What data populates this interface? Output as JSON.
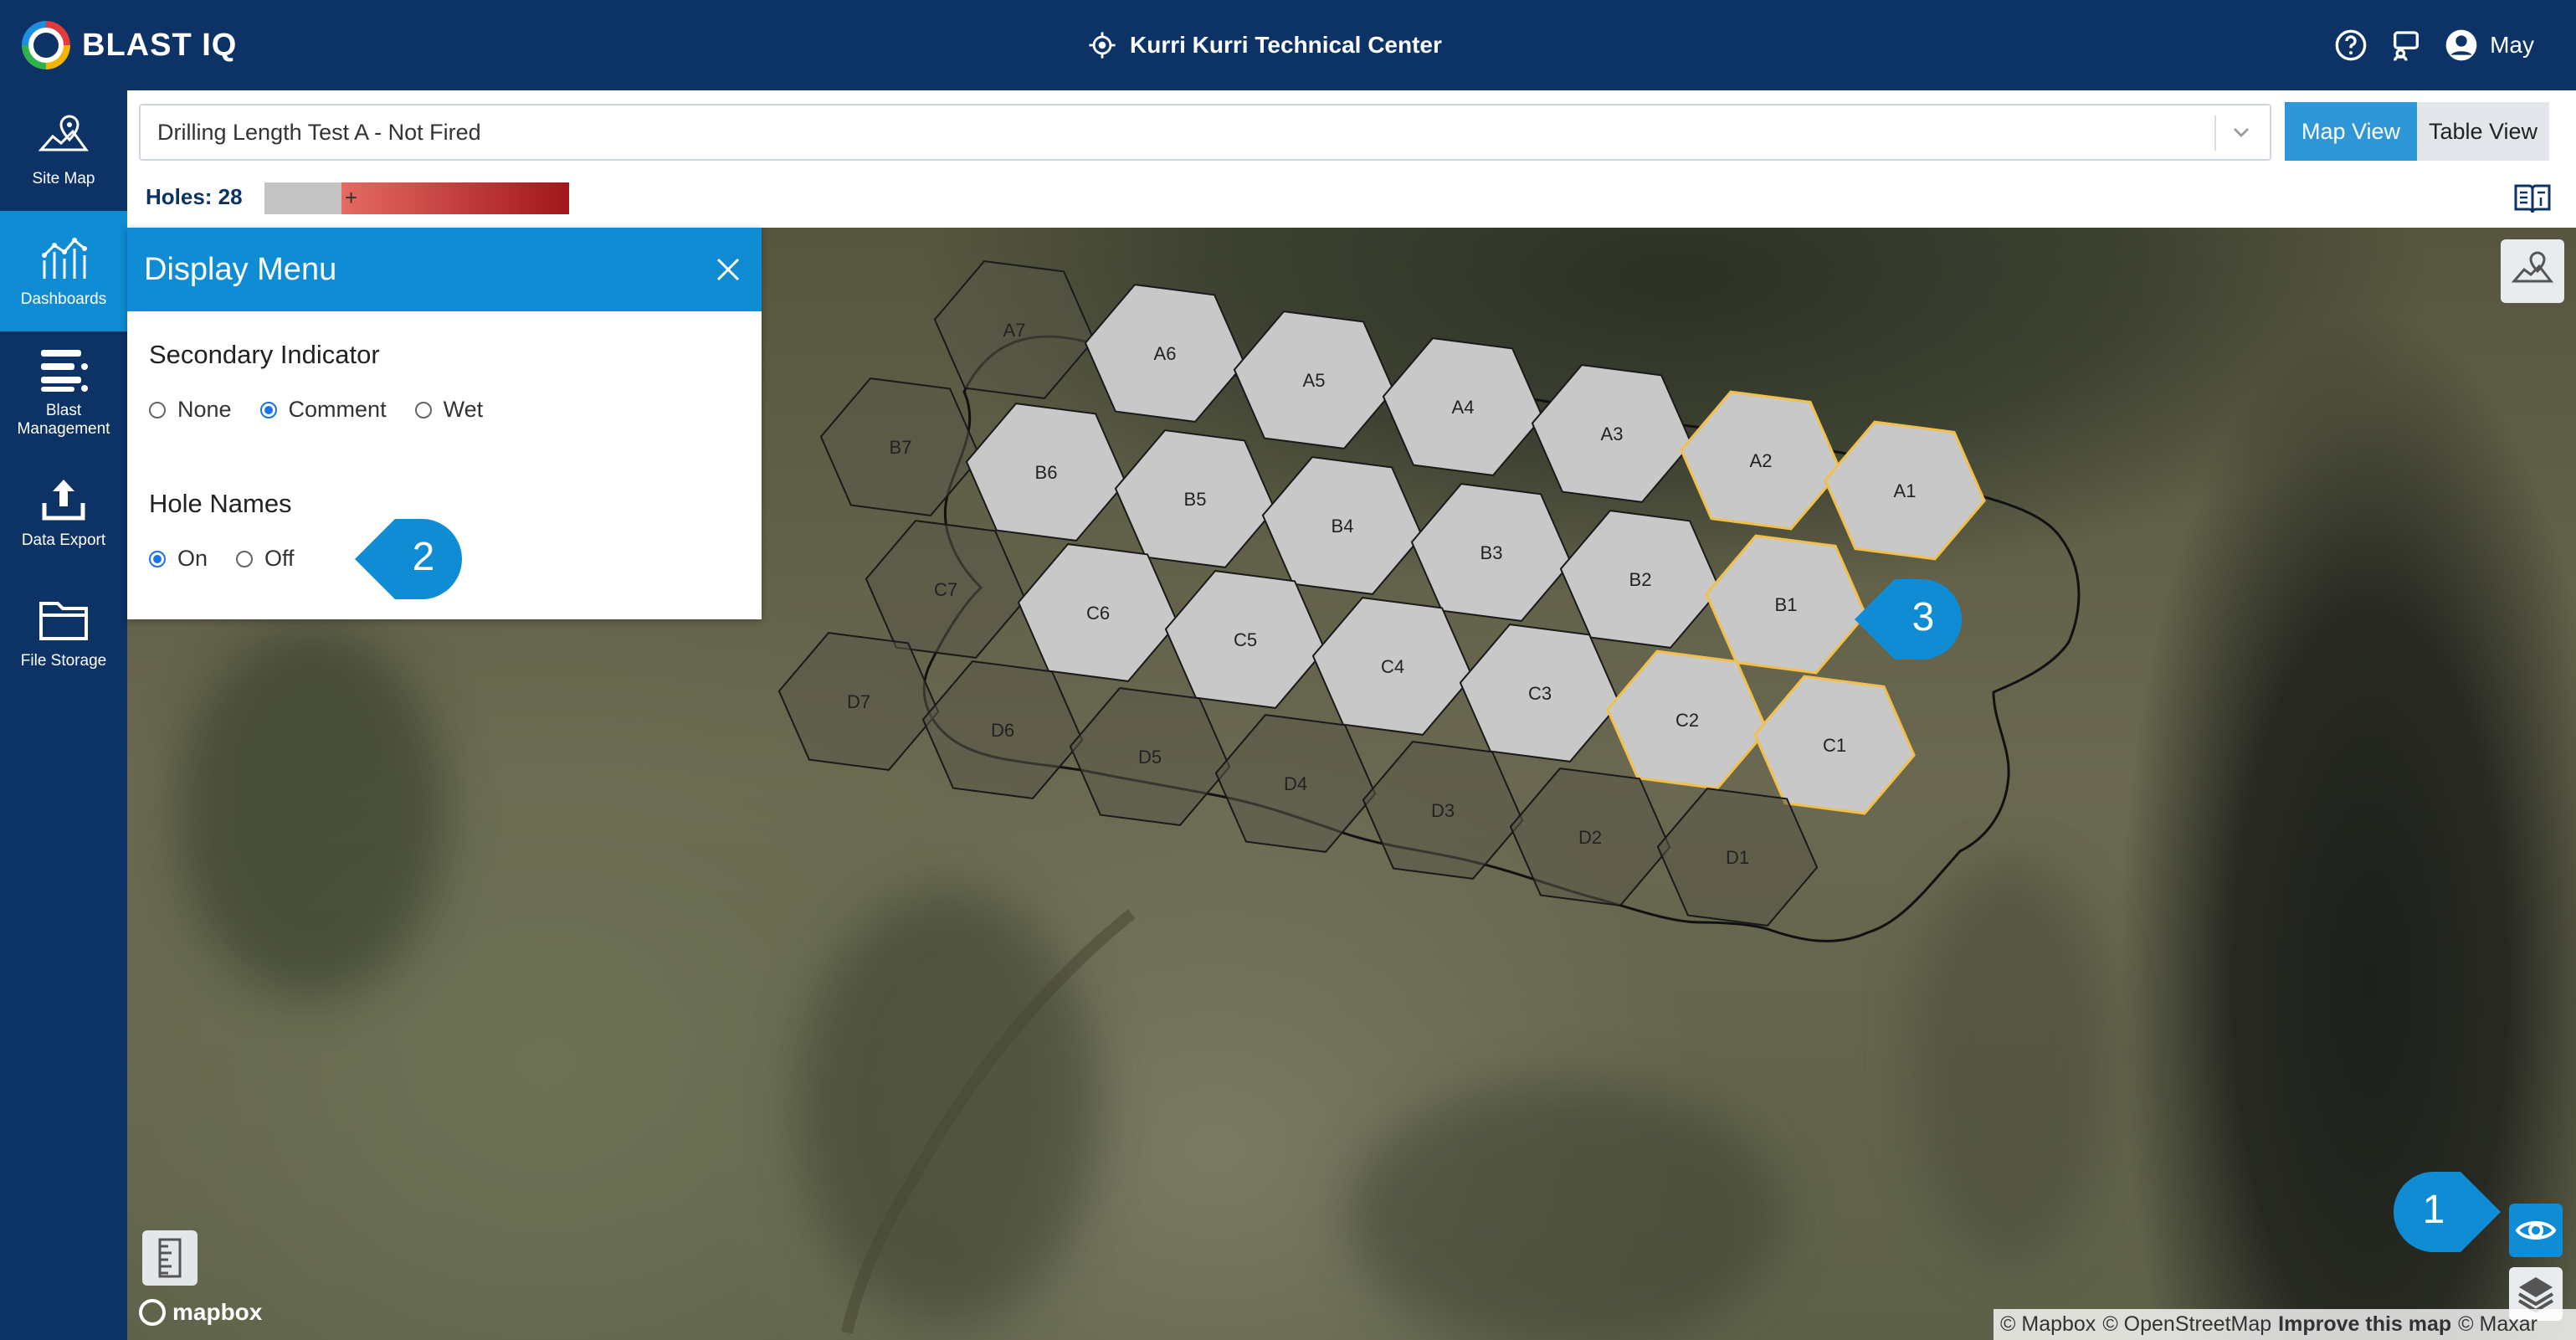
{
  "header": {
    "brand": "BLAST IQ",
    "site_title": "Kurri Kurri Technical Center",
    "user_name": "May"
  },
  "sidebar": {
    "items": [
      {
        "label": "Site Map",
        "icon": "map-pin-icon",
        "active": false
      },
      {
        "label": "Dashboards",
        "icon": "dashboard-icon",
        "active": true
      },
      {
        "label": "Blast Management",
        "icon": "list-icon",
        "active": false
      },
      {
        "label": "Data Export",
        "icon": "upload-icon",
        "active": false
      },
      {
        "label": "File Storage",
        "icon": "folder-icon",
        "active": false
      }
    ]
  },
  "toolbar": {
    "blast_select_value": "Drilling Length Test A - Not Fired",
    "map_view_label": "Map View",
    "table_view_label": "Table View",
    "holes_label": "Holes: 28",
    "legend_plus": "+"
  },
  "display_menu": {
    "title": "Display Menu",
    "secondary_indicator": {
      "heading": "Secondary Indicator",
      "options": [
        "None",
        "Comment",
        "Wet"
      ],
      "selected": "Comment"
    },
    "hole_names": {
      "heading": "Hole Names",
      "options": [
        "On",
        "Off"
      ],
      "selected": "On"
    }
  },
  "callouts": {
    "one": "1",
    "two": "2",
    "three": "3"
  },
  "holes": {
    "A7": "A7",
    "A6": "A6",
    "A5": "A5",
    "A4": "A4",
    "A3": "A3",
    "A2": "A2",
    "A1": "A1",
    "B7": "B7",
    "B6": "B6",
    "B5": "B5",
    "B4": "B4",
    "B3": "B3",
    "B2": "B2",
    "B1": "B1",
    "C7": "C7",
    "C6": "C6",
    "C5": "C5",
    "C4": "C4",
    "C3": "C3",
    "C2": "C2",
    "C1": "C1",
    "D7": "D7",
    "D6": "D6",
    "D5": "D5",
    "D4": "D4",
    "D3": "D3",
    "D2": "D2",
    "D1": "D1"
  },
  "colors": {
    "header_bg": "#0d3266",
    "accent": "#0f8cd3",
    "hole_grey": "#c8c8c8",
    "hole_highlight": "#f1c04a"
  },
  "mapbox_label": "mapbox",
  "attribution": {
    "mapbox": "© Mapbox",
    "osm": "© OpenStreetMap",
    "improve": "Improve this map",
    "maxar": "© Maxar"
  }
}
